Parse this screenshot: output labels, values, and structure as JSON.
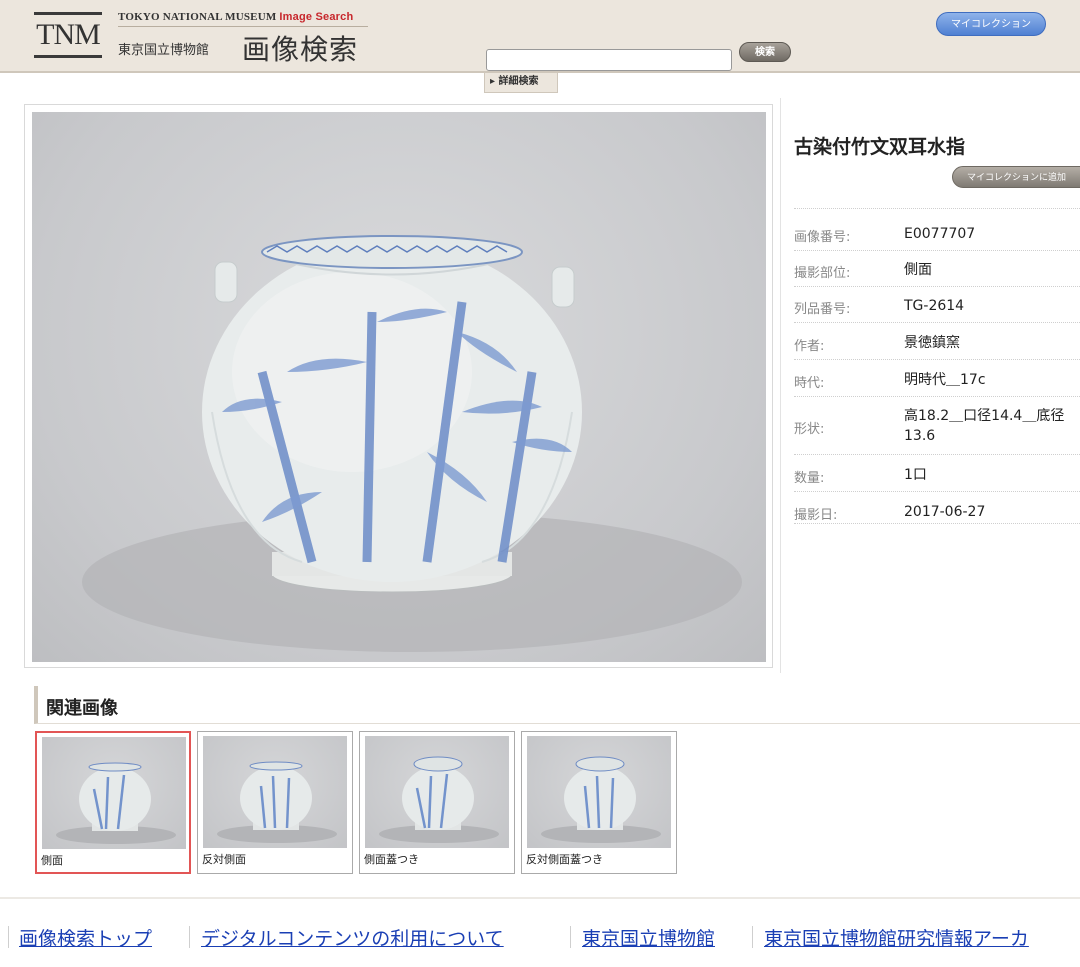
{
  "header": {
    "logo_text": "TNM",
    "en_title": "TOKYO NATIONAL MUSEUM",
    "en_accent": "Image Search",
    "jp_museum": "東京国立博物館",
    "jp_title": "画像検索",
    "search_placeholder": "",
    "search_button": "検索",
    "my_collection_button": "マイコレクション",
    "advanced_search_label": "▸ 詳細検索"
  },
  "item": {
    "title": "古染付竹文双耳水指",
    "add_to_collection_button": "マイコレクションに追加",
    "details": [
      {
        "label": "画像番号:",
        "value": "E0077707"
      },
      {
        "label": "撮影部位:",
        "value": "側面"
      },
      {
        "label": "列品番号:",
        "value": "TG-2614"
      },
      {
        "label": "作者:",
        "value": "景徳鎮窯"
      },
      {
        "label": "時代:",
        "value": "明時代＿17c"
      },
      {
        "label": "形状:",
        "value": "高18.2＿口径14.4＿底径13.6"
      },
      {
        "label": "数量:",
        "value": "1口"
      },
      {
        "label": "撮影日:",
        "value": "2017-06-27"
      }
    ]
  },
  "related": {
    "heading": "関連画像",
    "thumbnails": [
      {
        "caption": "側面",
        "selected": true
      },
      {
        "caption": "反対側面",
        "selected": false
      },
      {
        "caption": "側面蓋つき",
        "selected": false
      },
      {
        "caption": "反対側面蓋つき",
        "selected": false
      }
    ]
  },
  "footer": {
    "links": [
      "画像検索トップ",
      "デジタルコンテンツの利用について",
      "東京国立博物館",
      "東京国立博物館研究情報アーカ"
    ]
  },
  "colors": {
    "header_bg": "#ece6dd",
    "link": "#1a3fb4",
    "accent_red": "#c7272c",
    "collection_blue": "#4f80d2",
    "selected_border": "#e25555"
  }
}
